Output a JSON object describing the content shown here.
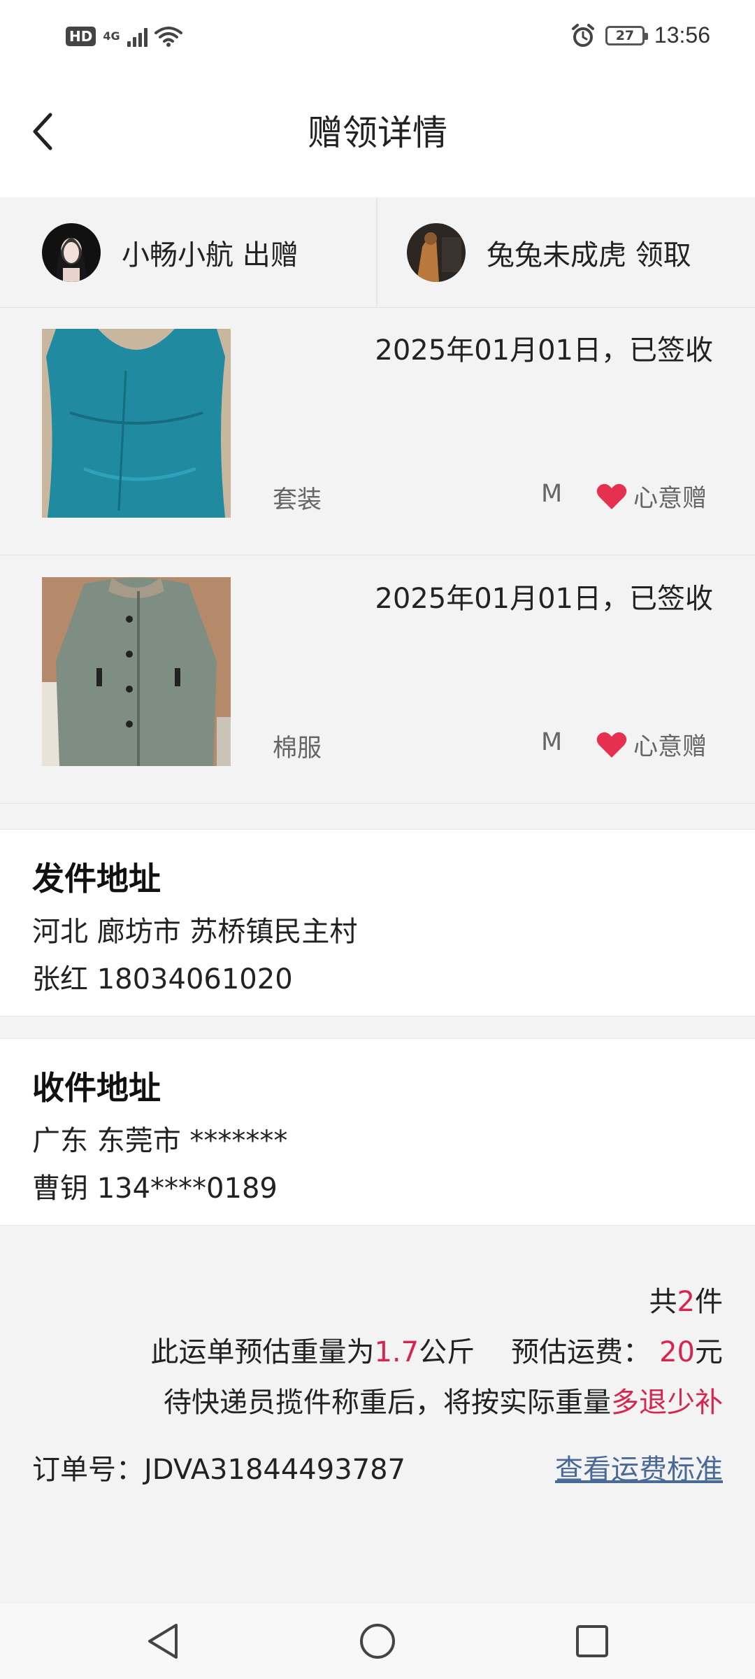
{
  "status_bar": {
    "hd": "HD",
    "network": "4G",
    "battery": "27",
    "time": "13:56"
  },
  "header": {
    "title": "赠领详情",
    "back_icon": "chevron-left-icon"
  },
  "users": {
    "giver_label": "小畅小航 出赠",
    "receiver_label": "兔兔未成虎 领取"
  },
  "items": [
    {
      "status": "2025年01月01日，已签收",
      "category": "套装",
      "size": "M",
      "tag": "心意赠",
      "thumb_color": "#1e8aa0"
    },
    {
      "status": "2025年01月01日，已签收",
      "category": "棉服",
      "size": "M",
      "tag": "心意赠",
      "thumb_color": "#7e8d80"
    }
  ],
  "sender_address": {
    "title": "发件地址",
    "address": "河北 廊坊市 苏桥镇民主村",
    "contact": "张红 18034061020"
  },
  "receiver_address": {
    "title": "收件地址",
    "address": "广东 东莞市 *******",
    "contact": "曹钥 134****0189"
  },
  "summary": {
    "total_prefix": "共",
    "total_count": "2",
    "total_suffix": "件",
    "weight_prefix": "此运单预估重量为",
    "weight_value": "1.7",
    "weight_unit": "公斤",
    "fee_prefix": "预估运费：",
    "fee_value": "20",
    "fee_unit": "元",
    "note_prefix": "待快递员揽件称重后，将按实际重量",
    "note_highlight": "多退少补",
    "order_label": "订单号：JDVA31844493787",
    "fee_link": "查看运费标准"
  },
  "colors": {
    "accent": "#d6254f",
    "link": "#4a6a96",
    "background": "#f3f3f3"
  }
}
